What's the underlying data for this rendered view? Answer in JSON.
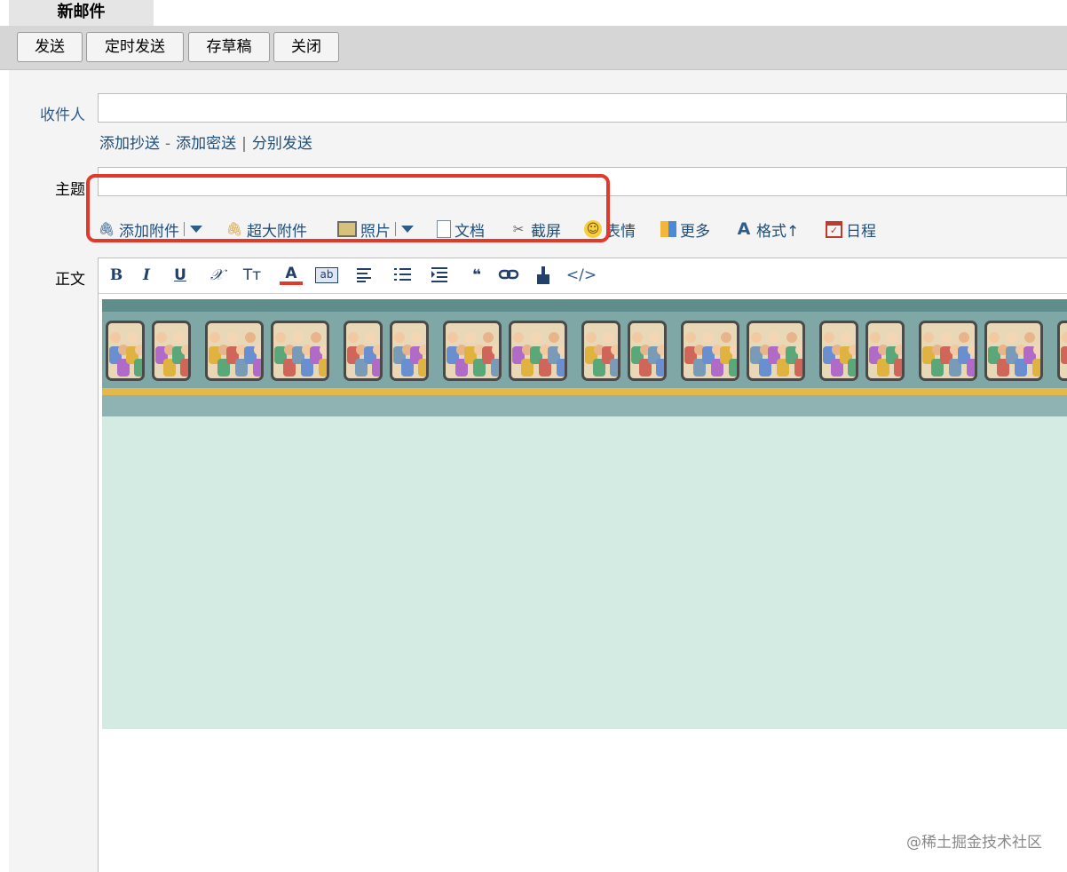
{
  "tab": {
    "title": "新邮件"
  },
  "toolbar": {
    "send": "发送",
    "scheduled_send": "定时发送",
    "save_draft": "存草稿",
    "close": "关闭"
  },
  "recipient": {
    "label": "收件人",
    "value": "",
    "add_cc": "添加抄送",
    "add_bcc": "添加密送",
    "separate_send": "分别发送",
    "dash": "-",
    "pipe": "|"
  },
  "subject": {
    "label": "主题",
    "value": ""
  },
  "attachments": {
    "add_attachment": "添加附件",
    "large_attachment": "超大附件",
    "photo": "照片",
    "document": "文档",
    "screenshot": "截屏",
    "emoji": "表情",
    "more": "更多",
    "format": "格式↑",
    "schedule": "日程"
  },
  "body": {
    "label": "正文"
  },
  "format_toolbar": {
    "bold": "B",
    "italic": "I",
    "underline": "U",
    "clear_format": "𝒳",
    "font_size": "Tт",
    "font_color": "A",
    "bg_color": "ab",
    "quote": "❝",
    "code": "</>"
  },
  "watermark": "@稀土掘金技术社区",
  "colors": {
    "highlight": "#e13a2d",
    "stationery_bg": "#d3ebe2",
    "link": "#1f4f7a"
  }
}
